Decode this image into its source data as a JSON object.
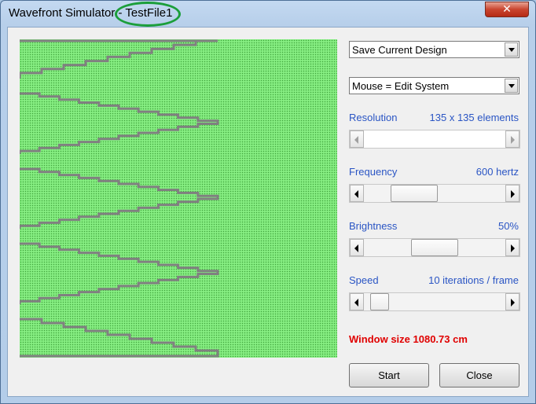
{
  "window": {
    "title_app": "Wavefront Simulator",
    "title_separator": " - ",
    "title_file": "TestFile1",
    "close_glyph": "✕",
    "highlight_color": "#1b9e3a"
  },
  "simulation": {
    "background_color": "#86ee82",
    "dot_color": "#42a63e",
    "lens_color": "#808080"
  },
  "controls": {
    "design_dropdown": {
      "selected": "Save Current Design"
    },
    "mouse_dropdown": {
      "selected": "Mouse = Edit System"
    },
    "resolution": {
      "label": "Resolution",
      "value": "135 x 135 elements",
      "enabled": false
    },
    "frequency": {
      "label": "Frequency",
      "value": "600 hertz",
      "position": 0.28
    },
    "brightness": {
      "label": "Brightness",
      "value": "50%",
      "position": 0.5
    },
    "speed": {
      "label": "Speed",
      "value": "10 iterations / frame",
      "position": 0.05
    },
    "window_size": "Window size 1080.73 cm",
    "start_label": "Start",
    "close_label": "Close"
  }
}
